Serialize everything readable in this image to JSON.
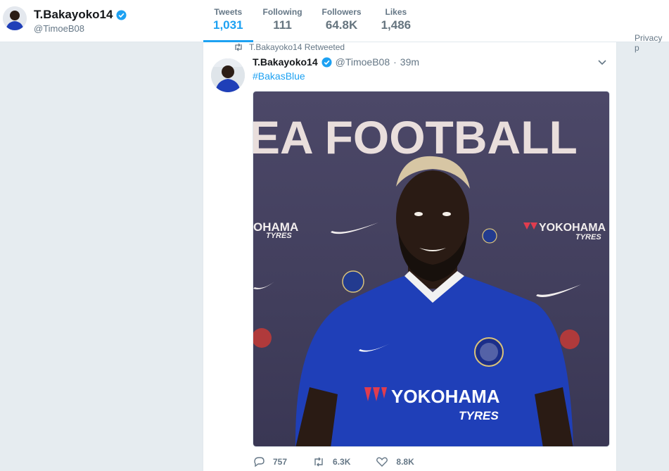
{
  "profile": {
    "name": "T.Bakayoko14",
    "handle": "@TimoeB08"
  },
  "stats": [
    {
      "label": "Tweets",
      "value": "1,031",
      "active": true
    },
    {
      "label": "Following",
      "value": "111",
      "active": false
    },
    {
      "label": "Followers",
      "value": "64.8K",
      "active": false
    },
    {
      "label": "Likes",
      "value": "1,486",
      "active": false
    }
  ],
  "tweet": {
    "retweet_context": "T.Bakayoko14 Retweeted",
    "author_name": "T.Bakayoko14",
    "author_handle": "@TimoeB08",
    "separator": "·",
    "time": "39m",
    "text": "#BakasBlue",
    "media_backdrop_text": "EA FOOTBALL",
    "sponsor_left": "OHAMA",
    "sponsor_left_sub": "TYRES",
    "sponsor_right": "YOKOHAMA",
    "sponsor_right_sub": "TYRES",
    "shirt_sponsor": "YOKOHAMA",
    "shirt_sponsor_sub": "TYRES",
    "replies": "757",
    "retweets": "6.3K",
    "likes": "8.8K"
  },
  "sidebar": {
    "privacy_text": "Privacy p"
  },
  "colors": {
    "accent": "#1da1f2",
    "muted": "#657786",
    "background": "#e6ecf0",
    "chelsea_blue": "#1f3fb8"
  }
}
